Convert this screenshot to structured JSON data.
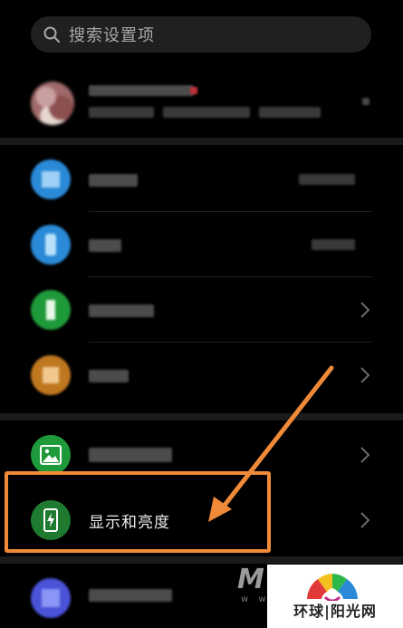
{
  "search": {
    "placeholder": "搜索设置项",
    "icon": "search-icon"
  },
  "rows": {
    "display": {
      "label": "显示和亮度",
      "icon": "phone-brightness-icon",
      "icon_color": "#1e7a2e"
    }
  },
  "colors": {
    "background": "#000000",
    "highlight": "#f08a38",
    "arrow": "#f08a38"
  },
  "watermark": {
    "text": "环球|阳光网"
  }
}
